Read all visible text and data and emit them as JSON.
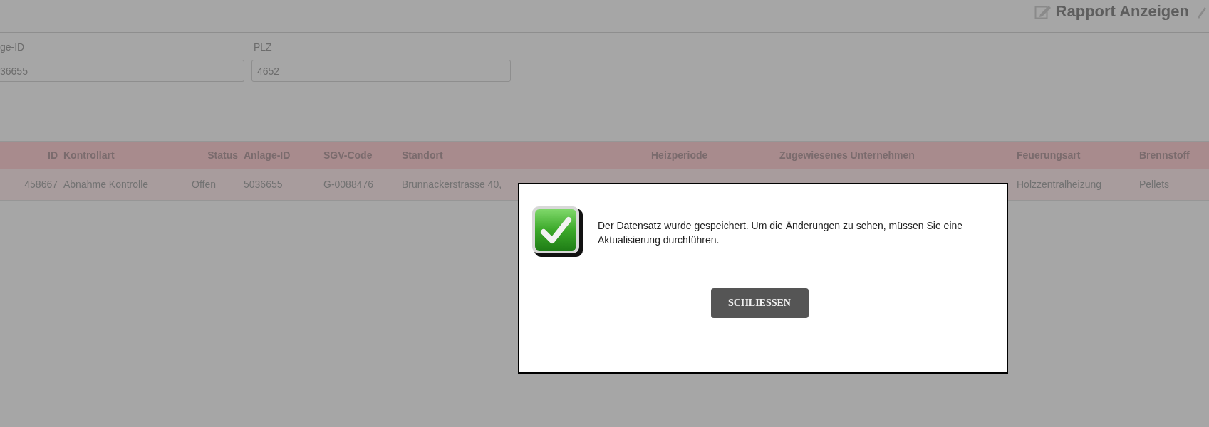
{
  "toolbar": {
    "report_button": "Rapport Anzeigen"
  },
  "filters": [
    {
      "label": "ge-ID",
      "value": "36655"
    },
    {
      "label": "PLZ",
      "value": "4652"
    }
  ],
  "table": {
    "columns": [
      "ID",
      "Kontrollart",
      "Status",
      "Anlage-ID",
      "SGV-Code",
      "Standort",
      "Heizperiode",
      "Zugewiesenes Unternehmen",
      "Feuerungsart",
      "Brennstoff"
    ],
    "rows": [
      [
        "458667",
        "Abnahme Kontrolle",
        "Offen",
        "5036655",
        "G-0088476",
        "Brunnackerstrasse 40,",
        "",
        "",
        "Holzzentralheizung",
        "Pellets"
      ]
    ]
  },
  "dialog": {
    "message": "Der Datensatz wurde gespeichert. Um die Änderungen zu sehen, müssen Sie eine Aktualisierung durchführen.",
    "button": "SCHLIESSEN"
  }
}
